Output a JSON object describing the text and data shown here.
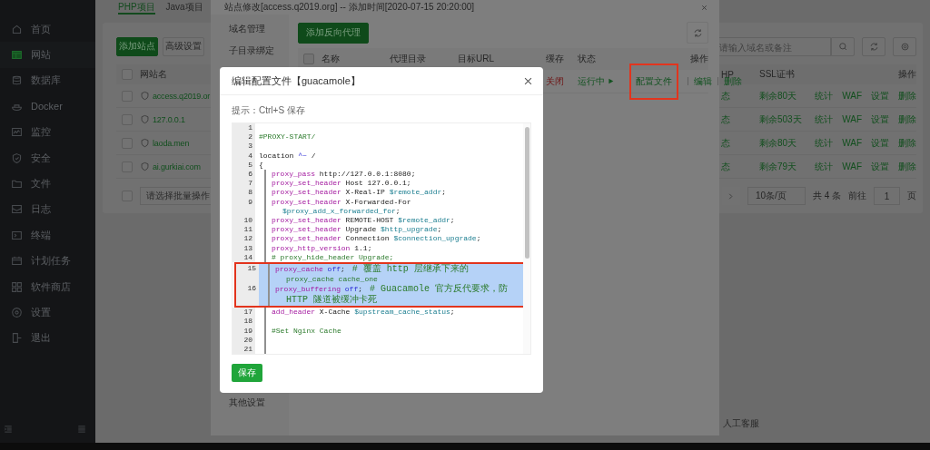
{
  "sidebar": {
    "items": [
      {
        "label": "首页",
        "selected": false
      },
      {
        "label": "网站",
        "selected": true
      },
      {
        "label": "数据库",
        "selected": false
      },
      {
        "label": "Docker",
        "selected": false
      },
      {
        "label": "监控",
        "selected": false
      },
      {
        "label": "安全",
        "selected": false
      },
      {
        "label": "文件",
        "selected": false
      },
      {
        "label": "日志",
        "selected": false
      },
      {
        "label": "终端",
        "selected": false
      },
      {
        "label": "计划任务",
        "selected": false
      },
      {
        "label": "软件商店",
        "selected": false
      },
      {
        "label": "设置",
        "selected": false
      },
      {
        "label": "退出",
        "selected": false
      }
    ]
  },
  "page": {
    "tabs": [
      {
        "label": "PHP项目",
        "selected": true
      },
      {
        "label": "Java项目",
        "selected": false
      }
    ],
    "buttons": [
      {
        "label": "添加站点",
        "kind": "primary"
      },
      {
        "label": "高级设置",
        "kind": "plain"
      }
    ],
    "search": {
      "placeholder": "请输入域名或备注"
    },
    "table": {
      "all_checked": false,
      "columns": [
        "网站名",
        "HP",
        "SSL证书",
        "操作"
      ],
      "rows": [
        {
          "checked": false,
          "name": "access.q2019.or",
          "column_2": "态",
          "ssl": "剩余80天",
          "actions": [
            "统计",
            "WAF",
            "设置",
            "删除"
          ]
        },
        {
          "checked": false,
          "name": "127.0.0.1",
          "column_2": "态",
          "ssl": "剩余503天",
          "actions": [
            "统计",
            "WAF",
            "设置",
            "删除"
          ]
        },
        {
          "checked": false,
          "name": "laoda.men",
          "column_2": "态",
          "ssl": "剩余80天",
          "actions": [
            "统计",
            "WAF",
            "设置",
            "删除"
          ]
        },
        {
          "checked": false,
          "name": "ai.gurkiai.com",
          "column_2": "态",
          "ssl": "剩余79天",
          "actions": [
            "统计",
            "WAF",
            "设置",
            "删除"
          ]
        }
      ]
    },
    "footer": {
      "batch_checked": false,
      "batch": {
        "placeholder": "请选择批量操作"
      },
      "page_size": "10条/页",
      "total": "共 4 条",
      "goto": "前往",
      "page": "1",
      "unit": "页"
    },
    "help": "人工客服"
  },
  "drawer": {
    "title": "站点修改[access.q2019.org] -- 添加时间[2020-07-15 20:20:00]",
    "nav": [
      "域名管理",
      "子目录绑定",
      "其他设置"
    ],
    "add_button": "添加反向代理",
    "table": {
      "all_checked": false,
      "columns": [
        "名称",
        "代理目录",
        "目标URL",
        "缓存",
        "状态",
        "操作"
      ],
      "rows": [
        {
          "cache": "关闭",
          "status": "运行中",
          "actions": [
            {
              "label": "配置文件",
              "highlighted": true
            },
            {
              "label": "编辑",
              "highlighted": false
            },
            {
              "label": "删除",
              "highlighted": false
            }
          ]
        }
      ]
    }
  },
  "modal": {
    "title": "编辑配置文件【guacamole】",
    "hint": "提示：Ctrl+S 保存",
    "selection_marked": true,
    "save_button": "保存",
    "lines": [
      {
        "number": "1",
        "indented": false,
        "selected": false
      },
      {
        "number": "2",
        "indented": false,
        "selected": false,
        "segments": [
          {
            "text": "#PROXY-START/",
            "kind": "comment"
          }
        ]
      },
      {
        "number": "3",
        "indented": false,
        "selected": false
      },
      {
        "number": "4",
        "indented": false,
        "selected": false,
        "segments": [
          {
            "text": "location ",
            "kind": "plain"
          },
          {
            "text": "^~",
            "kind": "value"
          },
          {
            "text": " /",
            "kind": "plain"
          }
        ]
      },
      {
        "number": "5",
        "indented": false,
        "selected": false,
        "segments": [
          {
            "text": "{",
            "kind": "plain"
          }
        ]
      },
      {
        "number": "6",
        "indented": true,
        "selected": false,
        "segments": [
          {
            "text": "proxy_pass",
            "kind": "keyword"
          },
          {
            "text": " http://127.0.0.1:8080;",
            "kind": "plain"
          }
        ]
      },
      {
        "number": "7",
        "indented": true,
        "selected": false,
        "segments": [
          {
            "text": "proxy_set_header",
            "kind": "keyword"
          },
          {
            "text": " Host 127.0.0.1;",
            "kind": "plain"
          }
        ]
      },
      {
        "number": "8",
        "indented": true,
        "selected": false,
        "segments": [
          {
            "text": "proxy_set_header",
            "kind": "keyword"
          },
          {
            "text": " X-Real-IP ",
            "kind": "plain"
          },
          {
            "text": "$remote_addr",
            "kind": "variable"
          },
          {
            "text": ";",
            "kind": "plain"
          }
        ]
      },
      {
        "number": "9",
        "indented": true,
        "selected": false,
        "segments": [
          {
            "text": "proxy_set_header",
            "kind": "keyword"
          },
          {
            "text": " X-Forwarded-For",
            "kind": "plain"
          }
        ],
        "continuation": [
          {
            "text": "$proxy_add_x_forwarded_for",
            "kind": "variable"
          },
          {
            "text": ";",
            "kind": "plain"
          }
        ]
      },
      {
        "number": "10",
        "indented": true,
        "selected": false,
        "segments": [
          {
            "text": "proxy_set_header",
            "kind": "keyword"
          },
          {
            "text": " REMOTE-HOST ",
            "kind": "plain"
          },
          {
            "text": "$remote_addr",
            "kind": "variable"
          },
          {
            "text": ";",
            "kind": "plain"
          }
        ]
      },
      {
        "number": "11",
        "indented": true,
        "selected": false,
        "segments": [
          {
            "text": "proxy_set_header",
            "kind": "keyword"
          },
          {
            "text": " Upgrade ",
            "kind": "plain"
          },
          {
            "text": "$http_upgrade",
            "kind": "variable"
          },
          {
            "text": ";",
            "kind": "plain"
          }
        ]
      },
      {
        "number": "12",
        "indented": true,
        "selected": false,
        "segments": [
          {
            "text": "proxy_set_header",
            "kind": "keyword"
          },
          {
            "text": " Connection ",
            "kind": "plain"
          },
          {
            "text": "$connection_upgrade",
            "kind": "variable"
          },
          {
            "text": ";",
            "kind": "plain"
          }
        ]
      },
      {
        "number": "13",
        "indented": true,
        "selected": false,
        "segments": [
          {
            "text": "proxy_http_version",
            "kind": "keyword"
          },
          {
            "text": " 1.1;",
            "kind": "plain"
          }
        ]
      },
      {
        "number": "14",
        "indented": true,
        "selected": false,
        "segments": [
          {
            "text": "# proxy_hide_header Upgrade;",
            "kind": "comment"
          }
        ]
      },
      {
        "number": "15",
        "indented": true,
        "selected": true,
        "segments": [
          {
            "text": "proxy_cache",
            "kind": "keyword"
          },
          {
            "text": " off",
            "kind": "value"
          },
          {
            "text": ";",
            "kind": "plain"
          },
          {
            "text": "# 覆盖 http 层继承下来的",
            "kind": "note"
          }
        ],
        "continuation": [
          {
            "text": "proxy_cache cache_one",
            "kind": "comment"
          }
        ]
      },
      {
        "number": "16",
        "indented": true,
        "selected": true,
        "segments": [
          {
            "text": "proxy_buffering",
            "kind": "keyword"
          },
          {
            "text": " off",
            "kind": "value"
          },
          {
            "text": ";",
            "kind": "plain"
          },
          {
            "text": "# Guacamole 官方反代要求，防",
            "kind": "note"
          }
        ],
        "continuation": [
          {
            "text": "HTTP 隧道被缓冲卡死",
            "kind": "note"
          }
        ]
      },
      {
        "number": "17",
        "indented": true,
        "selected": false,
        "segments": [
          {
            "text": "add_header",
            "kind": "keyword"
          },
          {
            "text": " X-Cache ",
            "kind": "plain"
          },
          {
            "text": "$upstream_cache_status",
            "kind": "variable"
          },
          {
            "text": ";",
            "kind": "plain"
          }
        ]
      },
      {
        "number": "18",
        "indented": true,
        "selected": false
      },
      {
        "number": "19",
        "indented": true,
        "selected": false,
        "segments": [
          {
            "text": "#Set Nginx Cache",
            "kind": "comment"
          }
        ]
      },
      {
        "number": "20",
        "indented": true,
        "selected": false
      },
      {
        "number": "21",
        "indented": true,
        "selected": false
      }
    ]
  }
}
